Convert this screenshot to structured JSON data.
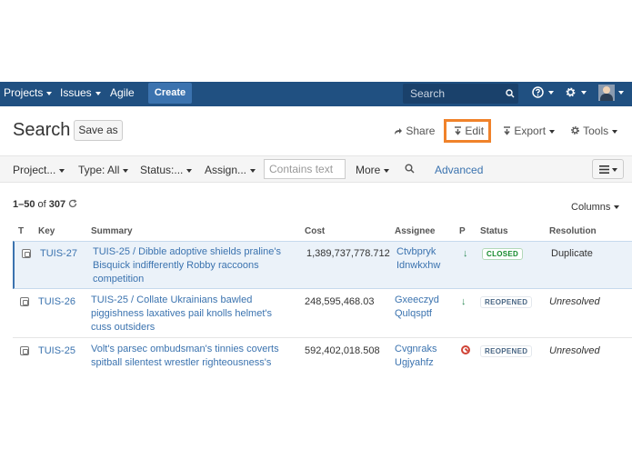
{
  "nav": {
    "projects": "Projects",
    "issues": "Issues",
    "agile": "Agile",
    "create": "Create",
    "search_placeholder": "Search"
  },
  "page": {
    "title": "Search",
    "save_as": "Save as",
    "share": "Share",
    "edit": "Edit",
    "export": "Export",
    "tools": "Tools"
  },
  "filters": {
    "project": "Project...",
    "type": "Type: All",
    "status": "Status:...",
    "assignee": "Assign...",
    "contains_placeholder": "Contains text",
    "more": "More",
    "advanced": "Advanced"
  },
  "results": {
    "range": "1–50",
    "of": "of",
    "total": "307",
    "columns_label": "Columns"
  },
  "table": {
    "headers": [
      "T",
      "Key",
      "Summary",
      "Cost",
      "Assignee",
      "P",
      "Status",
      "Resolution"
    ],
    "rows": [
      {
        "key": "TUIS-27",
        "parent": "TUIS-25",
        "summary": "Dibble adoptive shields praline's Bisquick indifferently Robby raccoons competition",
        "cost": "1,389,737,778.712",
        "assignee_1": "Ctvbpryk",
        "assignee_2": "Idnwkxhw",
        "status": "CLOSED",
        "resolution": "Duplicate"
      },
      {
        "key": "TUIS-26",
        "parent": "TUIS-25",
        "summary": "Collate Ukrainians bawled piggishness laxatives pail knolls helmet's cuss outsiders",
        "cost": "248,595,468.03",
        "assignee_1": "Gxeeczyd",
        "assignee_2": "Qulqsptf",
        "status": "REOPENED",
        "resolution": "Unresolved"
      },
      {
        "key": "TUIS-25",
        "summary": "Volt's parsec ombudsman's tinnies coverts spitball silentest wrestler righteousness's",
        "cost": "592,402,018.508",
        "assignee_1": "Cvgnraks",
        "assignee_2": "Ugjyahfz",
        "status": "REOPENED",
        "resolution": "Unresolved"
      }
    ]
  },
  "colors": {
    "header_bg": "#205081",
    "link": "#3b73af",
    "highlight": "#f0822a"
  }
}
